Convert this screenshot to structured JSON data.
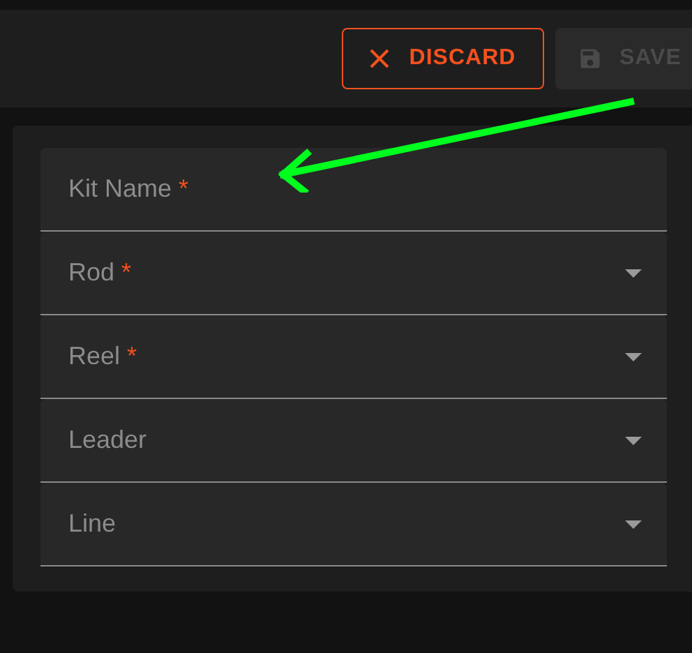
{
  "toolbar": {
    "buttons": [
      {
        "label": "DISCARD",
        "kind": "discard",
        "disabled": false
      },
      {
        "label": "SAVE",
        "kind": "save",
        "disabled": true
      }
    ]
  },
  "form": {
    "fields": [
      {
        "label": "Kit Name",
        "required_mark": "*",
        "kind": "text"
      },
      {
        "label": "Rod",
        "required_mark": "*",
        "kind": "select"
      },
      {
        "label": "Reel",
        "required_mark": "*",
        "kind": "select"
      },
      {
        "label": "Leader",
        "kind": "select"
      },
      {
        "label": "Line",
        "kind": "select"
      }
    ]
  }
}
